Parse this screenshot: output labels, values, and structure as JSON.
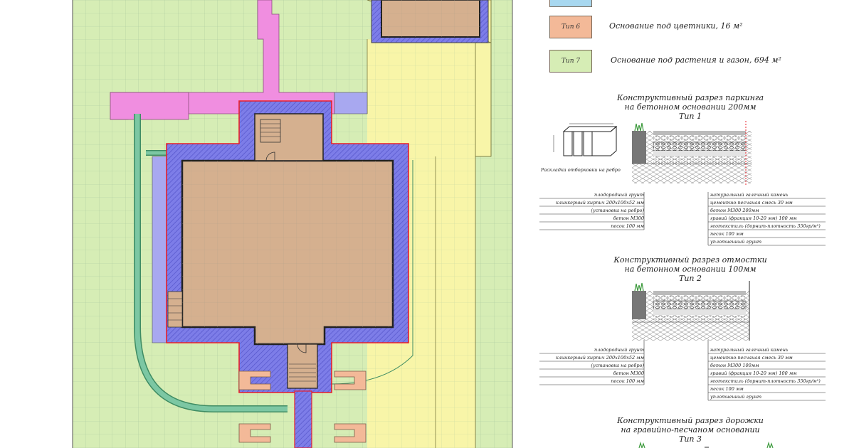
{
  "legend": {
    "top_swatch_color": "#a8d8f0",
    "items": [
      {
        "tag": "Тип 6",
        "text": "Основание под цветники, 16 м²",
        "color": "#f3b998"
      },
      {
        "tag": "Тип 7",
        "text": "Основание под растения и газон, 694 м²",
        "color": "#d6edb5"
      }
    ]
  },
  "section1": {
    "title_lines": [
      "Конструктивный разрез паркинга",
      "на бетонном основании 200мм",
      "Тип 1"
    ],
    "brick_caption": "Раскладка отборковки на ребро",
    "left_labels": [
      "плодородный грунт",
      "клинкерный кирпич 200х100х52 мм",
      "(установка на ребро)",
      "бетон М300",
      "песок 100 мм"
    ],
    "right_labels": [
      "натуральный галечный камень",
      "цементно-песчаная смесь 30 мм",
      "бетон М300 200мм",
      "гравий (фракция 10-20 мм) 100 мм",
      "геотекстиль (дорнит-плотность 350гр/м²)",
      "песок 100 мм",
      "уплотненный грунт"
    ]
  },
  "section2": {
    "title_lines": [
      "Конструктивный разрез отмостки",
      "на бетонном основании 100мм",
      "Тип 2"
    ],
    "left_labels": [
      "плодородный грунт",
      "клинкерный кирпич 200х100х52 мм",
      "(установка на ребро)",
      "бетон М300",
      "песок 100 мм"
    ],
    "right_labels": [
      "натуральный галечный камень",
      "цементно-песчаная смесь 30 мм",
      "бетон М300 100мм",
      "гравий (фракция 10-20 мм) 100 мм",
      "геотекстиль (дорнит-плотность 350гр/м²)",
      "песок 100 мм",
      "уплотненный грунт"
    ]
  },
  "section3": {
    "title_lines": [
      "Конструктивный разрез дорожки",
      "на гравийно-песчаном основании",
      "Тип 3"
    ]
  },
  "colors": {
    "lawn": "#d6edb5",
    "grid": "#a9c9a0",
    "building": "#d5b08f",
    "wall_hatch": "#7d7de8",
    "pink": "#f08ee0",
    "yellow": "#f8f5a8",
    "path_green": "#7cc7a3",
    "red_outline": "#e8202a",
    "planter": "#f3b998"
  }
}
